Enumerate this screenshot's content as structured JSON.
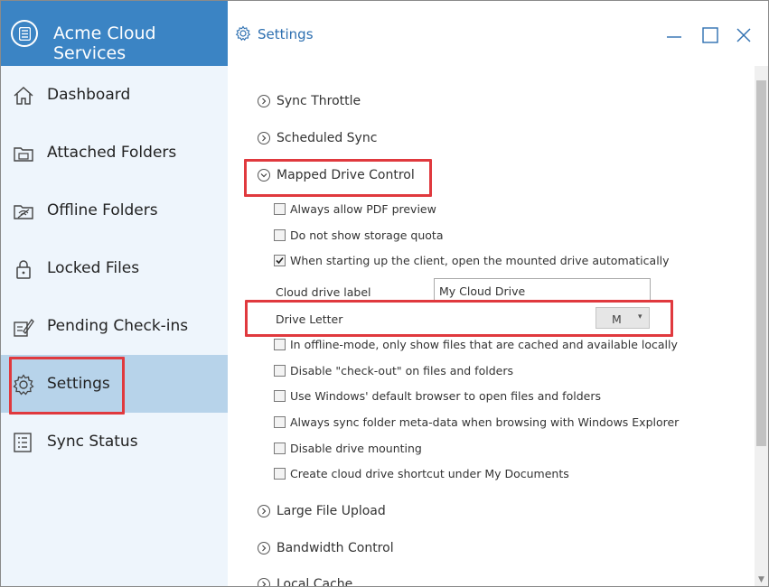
{
  "app": {
    "name": "Acme Cloud Services",
    "page_title": "Settings"
  },
  "colors": {
    "brand": "#3b84c4",
    "sidebar_bg": "#eef5fc",
    "active_bg": "#b7d3ea",
    "highlight": "#e0393e"
  },
  "sidebar": {
    "items": [
      {
        "label": "Dashboard",
        "icon": "home-icon"
      },
      {
        "label": "Attached Folders",
        "icon": "folder-icon"
      },
      {
        "label": "Offline Folders",
        "icon": "offline-folder-icon"
      },
      {
        "label": "Locked Files",
        "icon": "lock-icon"
      },
      {
        "label": "Pending Check-ins",
        "icon": "pending-checkin-icon"
      },
      {
        "label": "Settings",
        "icon": "gear-icon",
        "active": true
      },
      {
        "label": "Sync Status",
        "icon": "sync-status-icon"
      }
    ]
  },
  "sections": {
    "sync_throttle": "Sync Throttle",
    "scheduled_sync": "Scheduled Sync",
    "mapped_drive_control": "Mapped Drive Control",
    "large_file_upload": "Large File Upload",
    "bandwidth_control": "Bandwidth Control",
    "local_cache": "Local Cache"
  },
  "mapped_drive": {
    "options": [
      {
        "label": "Always allow PDF preview",
        "checked": false
      },
      {
        "label": "Do not show storage quota",
        "checked": false
      },
      {
        "label": "When starting up the client, open the mounted drive automatically",
        "checked": true
      }
    ],
    "cloud_drive_label": {
      "label": "Cloud drive label",
      "value": "My Cloud Drive"
    },
    "drive_letter": {
      "label": "Drive Letter",
      "value": "M"
    },
    "more_options": [
      {
        "label": "In offline-mode, only show files that are cached and available locally",
        "checked": false
      },
      {
        "label": "Disable \"check-out\" on files and folders",
        "checked": false
      },
      {
        "label": "Use Windows' default browser to open files and folders",
        "checked": false
      },
      {
        "label": "Always sync folder meta-data when browsing with Windows Explorer",
        "checked": false
      },
      {
        "label": "Disable drive mounting",
        "checked": false
      },
      {
        "label": "Create cloud drive shortcut under My Documents",
        "checked": false
      }
    ]
  }
}
